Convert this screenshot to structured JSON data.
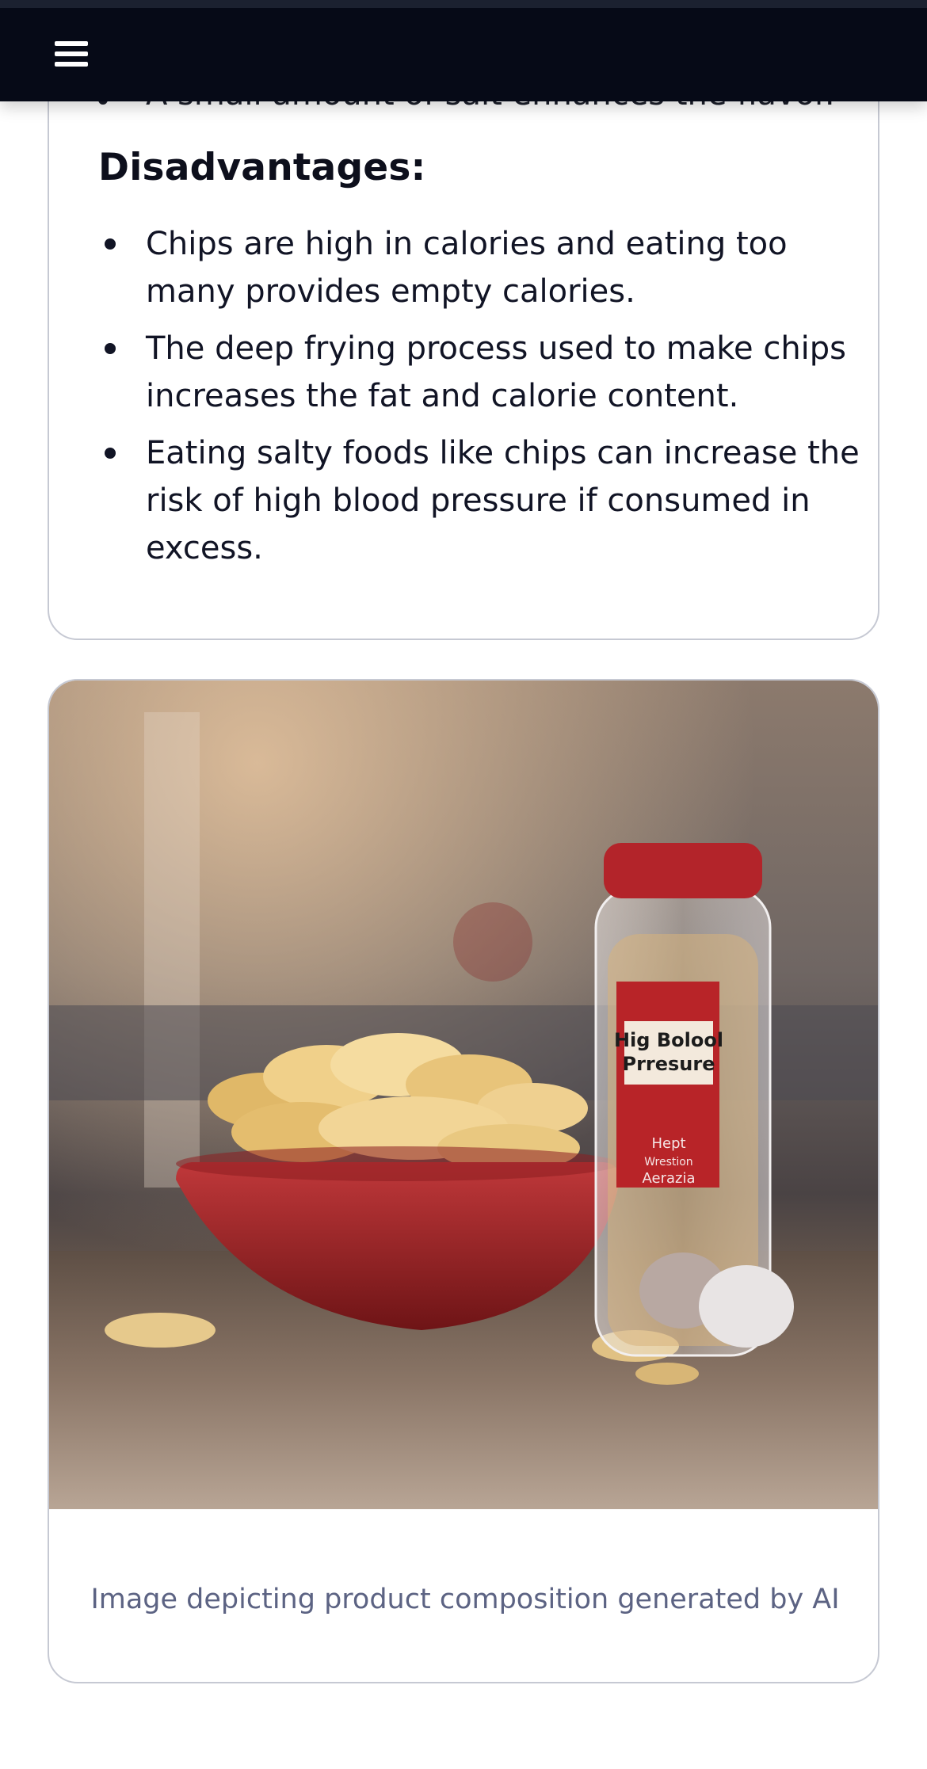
{
  "header": {
    "menu_icon": "hamburger-menu-icon"
  },
  "content": {
    "truncated_text": "A small amount of salt enhances the flavor.",
    "section_title": "Disadvantages:",
    "disadvantages": [
      "Chips are high in calories and eating too many provides empty calories.",
      "The deep frying process used to make chips increases the fat and calorie content.",
      "Eating salty foods like chips can increase the risk of high blood pressure if consumed in excess."
    ]
  },
  "figure": {
    "label_line1": "Hig Bolool",
    "label_line2": "Prresure",
    "label_line3": "Hept",
    "label_line4": "Wrestion",
    "label_line5": "Aerazia",
    "caption": "Image depicting product composition generated by AI"
  },
  "colors": {
    "topbar": "#060a17",
    "card_border": "#c6c9d3",
    "caption": "#5c6383",
    "bowl": "#a8262a",
    "bottle_cap": "#b3242a"
  }
}
